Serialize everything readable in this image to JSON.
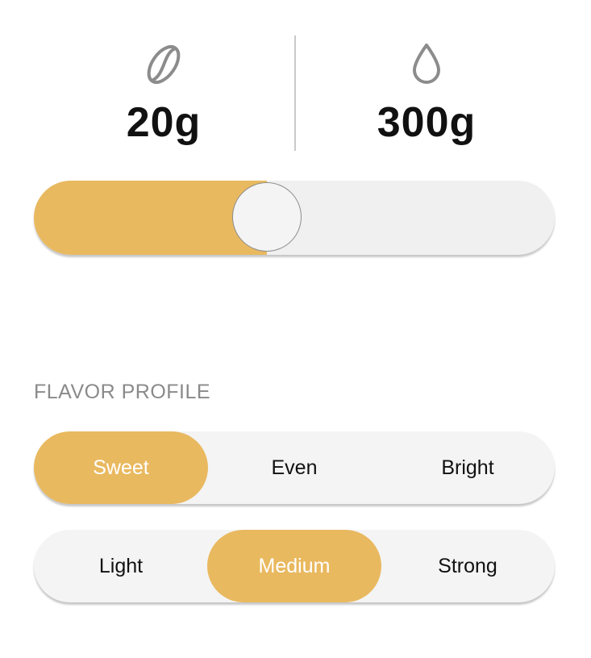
{
  "amounts": {
    "coffee": {
      "icon": "coffee-bean-icon",
      "value": "20g"
    },
    "water": {
      "icon": "water-drop-icon",
      "value": "300g"
    }
  },
  "ratio_slider": {
    "value_fraction": 0.44
  },
  "flavor_profile": {
    "title": "FLAVOR PROFILE",
    "taste": {
      "options": [
        "Sweet",
        "Even",
        "Bright"
      ],
      "selected": "Sweet"
    },
    "strength": {
      "options": [
        "Light",
        "Medium",
        "Strong"
      ],
      "selected": "Medium"
    }
  },
  "colors": {
    "accent": "#e9b960",
    "track": "#f0f0f0",
    "label_gray": "#8a8a8a",
    "icon_gray": "#8c8c8c"
  }
}
